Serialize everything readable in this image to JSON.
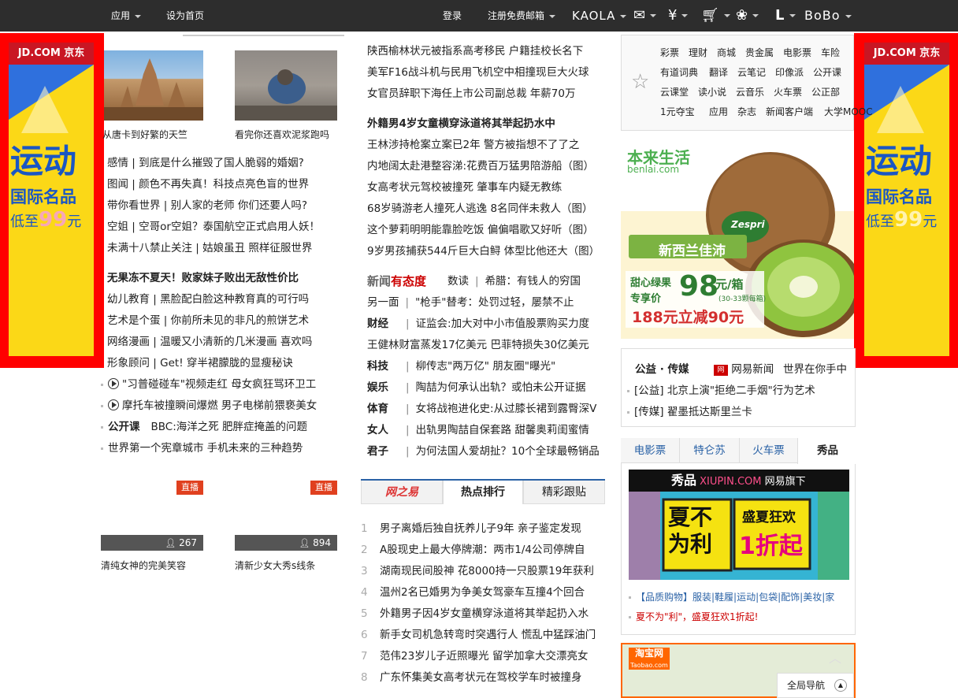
{
  "topbar": {
    "left": [
      {
        "label": "应用",
        "dropdown": true
      },
      {
        "label": "设为首页",
        "dropdown": false
      }
    ],
    "login": "登录",
    "register": "注册免费邮箱",
    "kaola": "KAOLA",
    "account_initial": "L",
    "username": "BoBo"
  },
  "side_ad": {
    "logo": "JD.COM 京东",
    "line1": "运动",
    "line2": "国际名品",
    "line3_prefix": "低至",
    "line3_price": "99",
    "line3_suffix": "元"
  },
  "photos": [
    {
      "caption": "从唐卡到好繁的天竺"
    },
    {
      "caption": "看完你还喜欢泥浆跑吗"
    }
  ],
  "left_news": [
    {
      "text": "感情 | 到底是什么摧毁了国人脆弱的婚姻?"
    },
    {
      "text": "图闻 | 颜色不再失真！科技点亮色盲的世界"
    },
    {
      "text": "带你看世界 | 别人家的老师 你们还要人吗?"
    },
    {
      "text": "空姐 | 空哥or空姐？泰国航空正式启用人妖！"
    },
    {
      "text": "未满十八禁止关注 | 姑娘虽丑 照样征服世界"
    },
    {
      "text": "无果冻不夏天！败家妹子败出无敌性价比",
      "bold": true
    },
    {
      "text": "幼儿教育 | 黑脸配白脸这种教育真的可行吗"
    },
    {
      "text": "艺术是个蛋 | 你前所未见的非凡的煎饼艺术"
    },
    {
      "text": "网络漫画 | 温暖又小清新的几米漫画 喜欢吗"
    },
    {
      "text": "形象顾问 | Get! 穿半裙朦胧的显瘦秘诀"
    },
    {
      "text": "\"习普碰碰车\"视频走红 母女疯狂骂环卫工",
      "icon": "play"
    },
    {
      "text": "摩托车被撞瞬间爆燃 男子电梯前猥亵美女",
      "icon": "play"
    },
    {
      "text": "BBC:海洋之死 肥胖症掩盖的问题",
      "label": "公开课"
    },
    {
      "text": "世界第一个宪章城市 手机未来的三种趋势",
      "icon": "dot"
    }
  ],
  "live": {
    "badge": "直播",
    "items": [
      {
        "viewers": "267",
        "caption": "清纯女神的完美笑容"
      },
      {
        "viewers": "894",
        "caption": "清新少女大秀s线条"
      }
    ]
  },
  "mid_news": [
    {
      "text": "陕西榆林状元被指系高考移民 户籍挂校长名下"
    },
    {
      "text": "美军F16战斗机与民用飞机空中相撞现巨大火球"
    },
    {
      "text": "女官员辞职下海任上市公司副总裁 年薪70万"
    },
    {
      "text": "外籍男4岁女童横穿泳道将其举起扔水中",
      "bold": true
    },
    {
      "text": "王林涉持枪案立案已2年 警方被指想不了了之"
    },
    {
      "text": "内地阔太赴港整容涕:花费百万猛男陪游船（图）"
    },
    {
      "text": "女高考状元驾校被撞死 肇事车内疑无教练"
    },
    {
      "text": "68岁骑游老人撞死人逃逸 8名同伴未救人（图）"
    },
    {
      "text": "这个萝莉明明能靠脸吃饭 偏偏唱歌又好听（图）"
    },
    {
      "text": "9岁男孩捕获544斤巨大白鲟 体型比他还大（图）"
    }
  ],
  "attitude": {
    "logo_a": "新闻",
    "logo_b": "有态度",
    "items": [
      {
        "label": "数读",
        "text": "希腊：有钱人的穷国"
      },
      {
        "label": "另一面",
        "text": "\"枪手\"替考：处罚过轻，屡禁不止"
      },
      {
        "label": "财经",
        "text": "证监会:加大对中小市值股票购买力度",
        "bold": true
      },
      {
        "label": "王健林财富蒸发17亿美元",
        "text": "巴菲特损失30亿美元"
      },
      {
        "label": "科技",
        "text": "柳传志\"两万亿\" 朋友圈\"曝光\"",
        "bold": true
      },
      {
        "label": "娱乐",
        "text": "陶喆为何承认出轨？或怕未公开证据",
        "bold": true
      },
      {
        "label": "体育",
        "text": "女将战袍进化史:从过膝长裙到露臀深V",
        "bold": true
      },
      {
        "label": "女人",
        "text": "出轨男陶喆自保套路 甜馨奥莉闺蜜情",
        "bold": true
      },
      {
        "label": "君子",
        "text": "为何法国人爱胡扯？10个全球最畅销品",
        "bold": true
      }
    ]
  },
  "hot_tabs": [
    "网之易",
    "热点排行",
    "精彩跟贴"
  ],
  "hot_list": [
    {
      "n": "1",
      "text": "男子离婚后独自抚养儿子9年 亲子鉴定发现"
    },
    {
      "n": "2",
      "text": "A股现史上最大停牌潮：两市1/4公司停牌自"
    },
    {
      "n": "3",
      "text": "湖南现民间股神 花8000持一只股票19年获利"
    },
    {
      "n": "4",
      "text": "温州2名已婚男为争美女驾豪车互撞4个回合"
    },
    {
      "n": "5",
      "text": "外籍男子因4岁女童横穿泳道将其举起扔入水"
    },
    {
      "n": "6",
      "text": "新手女司机急转弯时突遇行人 慌乱中猛踩油门"
    },
    {
      "n": "7",
      "text": "范伟23岁儿子近照曝光 留学加拿大交漂亮女"
    },
    {
      "n": "8",
      "text": "广东怀集美女高考状元在驾校学车时被撞身"
    }
  ],
  "services": [
    [
      "彩票",
      "理财",
      "商城",
      "贵金属",
      "电影票",
      "车险"
    ],
    [
      "有道词典",
      "翻译",
      "云笔记",
      "印像派",
      "公开课"
    ],
    [
      "云课堂",
      "读小说",
      "云音乐",
      "火车票",
      "公正部"
    ],
    [
      "1元夺宝",
      "应用",
      "杂志",
      "新闻客户端",
      "大学MOOC"
    ]
  ],
  "kiwi_ad": {
    "brand": "本来生活",
    "domain": "benlai.com",
    "fruit_label": "新西兰佳沛",
    "box_label_1": "甜心绿果",
    "box_label_2": "专享价",
    "price": "98",
    "unit": "元/箱",
    "spec": "(30-33颗每箱)",
    "promo": "188元立减90元",
    "zespri": "Zespri"
  },
  "public": {
    "title": "公益 · 传媒",
    "brand": "网易新闻",
    "slogan": "世界在你手中",
    "items": [
      "[公益] 北京上演\"拒绝二手烟\"行为艺术",
      "[传媒] 翟墨抵达斯里兰卡"
    ]
  },
  "right_tabs": [
    "电影票",
    "特仑苏",
    "火车票",
    "秀品"
  ],
  "xiupin": {
    "logo": "秀品",
    "domain": "XIUPIN.COM",
    "sub": "网易旗下",
    "big1": "夏不",
    "big2": "为利",
    "promo": "盛夏狂欢",
    "promo2": "1折起"
  },
  "xiupin_links": [
    "【品质购物】服装|鞋履|运动|包袋|配饰|美妆|家",
    "夏不为\"利\"，盛夏狂欢1折起!"
  ],
  "taobao": {
    "label": "淘宝网",
    "domain": "Taobao.com"
  },
  "global_nav": "全局导航",
  "colors": {
    "topbar": "#2d2d2d",
    "accent_red": "#e0401f",
    "link_blue": "#2a62a6",
    "side_ad_red": "#ff0000",
    "ad_yellow": "#fbd817"
  }
}
